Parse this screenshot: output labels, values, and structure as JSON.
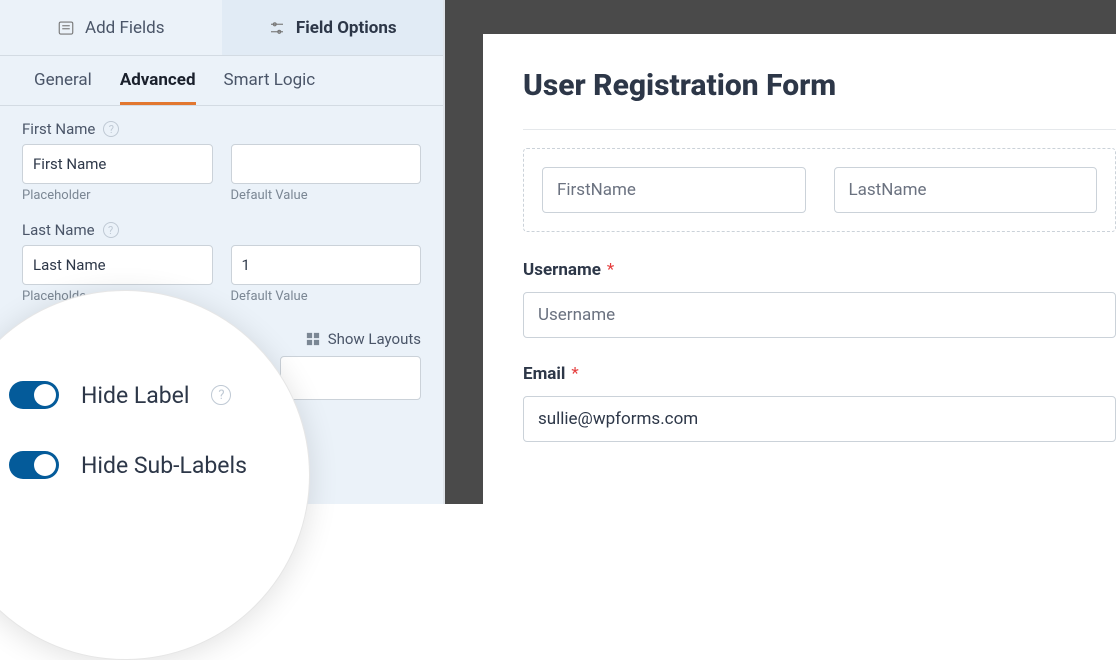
{
  "panel": {
    "topTabs": {
      "addFields": "Add Fields",
      "fieldOptions": "Field Options"
    },
    "subTabs": {
      "general": "General",
      "advanced": "Advanced",
      "smartLogic": "Smart Logic"
    },
    "firstName": {
      "label": "First Name",
      "placeholderValue": "First Name",
      "placeholderCaption": "Placeholder",
      "defaultValue": "",
      "defaultCaption": "Default Value"
    },
    "lastName": {
      "label": "Last Name",
      "placeholderValue": "Last Name",
      "placeholderCaption": "Placeholde",
      "defaultValue": "1",
      "defaultCaption": "Default Value"
    },
    "showLayouts": "Show Layouts"
  },
  "zoom": {
    "hideLabel": "Hide Label",
    "hideSubLabels": "Hide Sub-Labels"
  },
  "preview": {
    "title": "User Registration Form",
    "firstNamePlaceholder": "FirstName",
    "lastNamePlaceholder": "LastName",
    "usernameLabel": "Username",
    "usernamePlaceholder": "Username",
    "emailLabel": "Email",
    "emailValue": "sullie@wpforms.com",
    "required": "*"
  }
}
